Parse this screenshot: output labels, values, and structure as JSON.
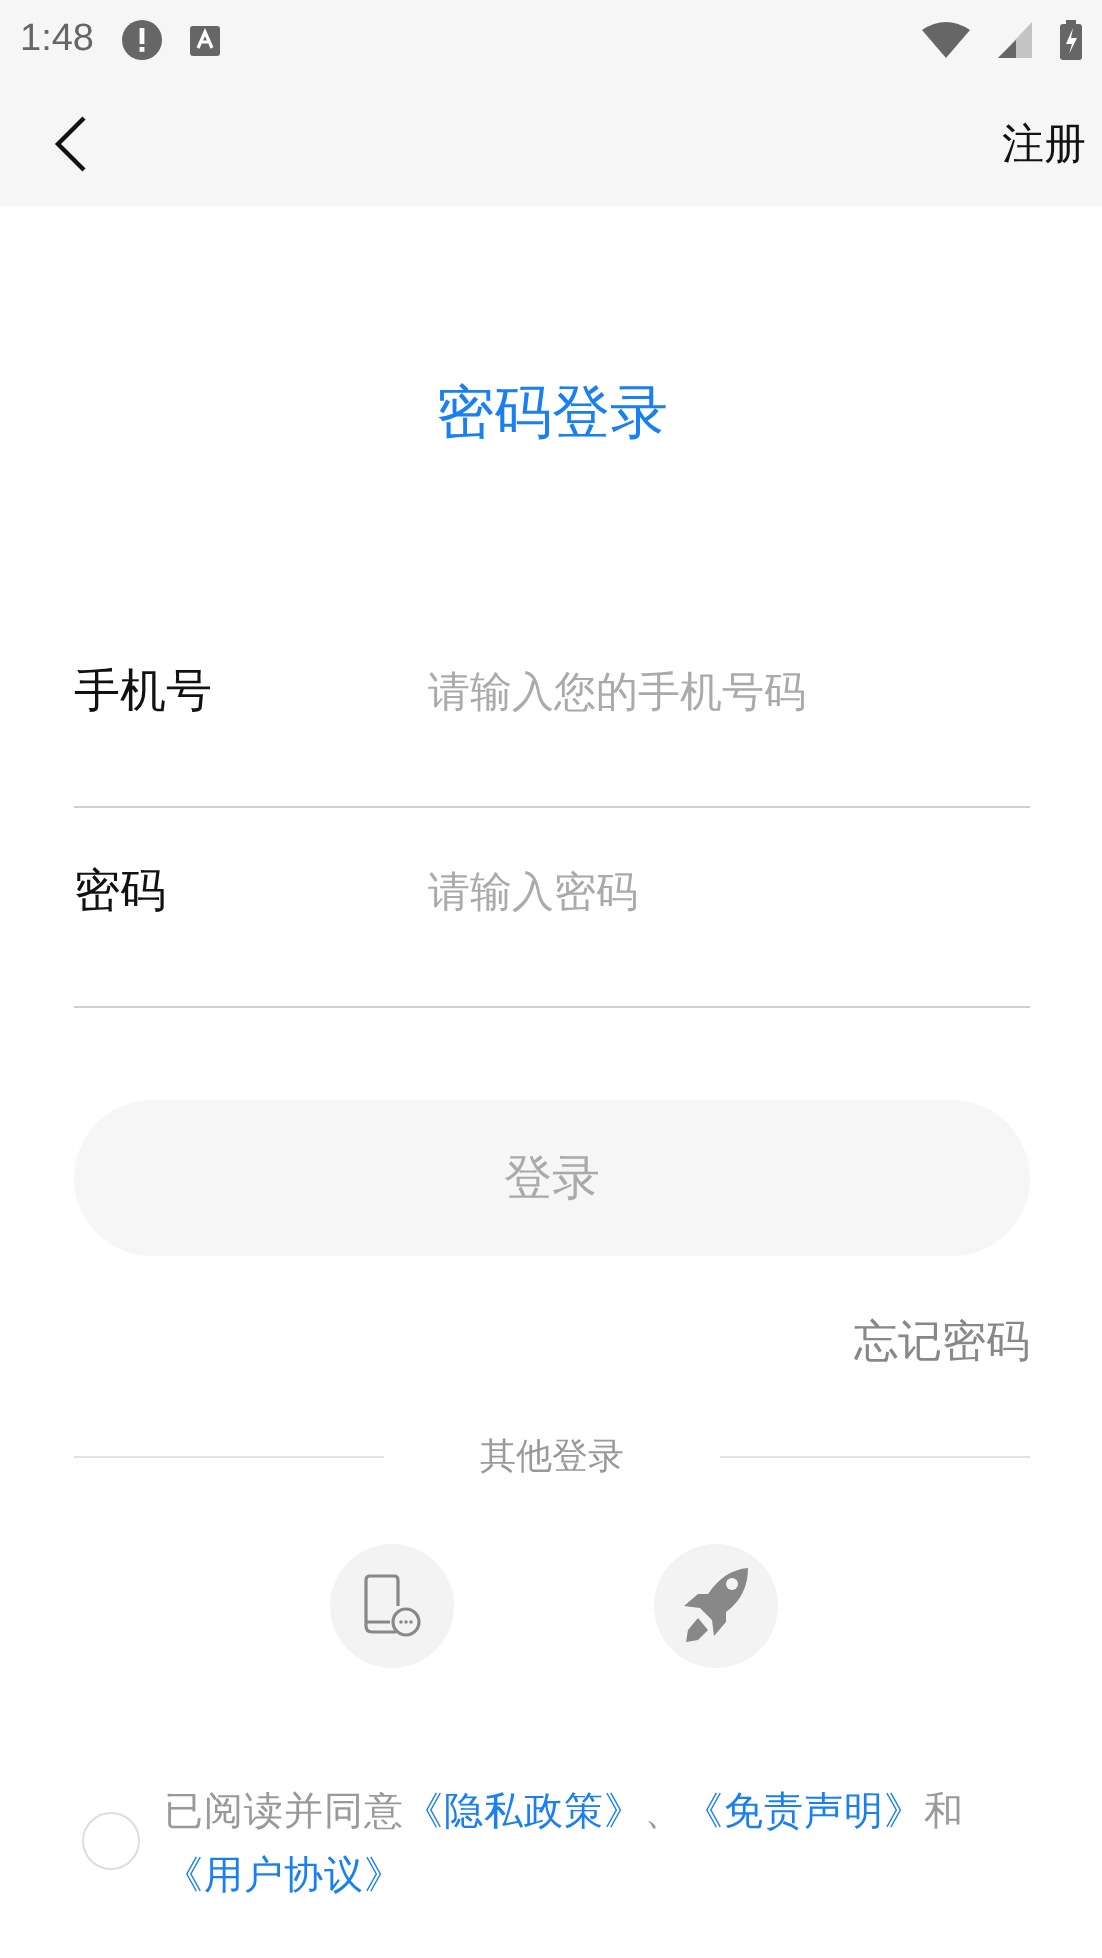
{
  "status_bar": {
    "time": "1:48"
  },
  "header": {
    "action": "注册"
  },
  "title": "密码登录",
  "fields": [
    {
      "label": "手机号",
      "placeholder": "请输入您的手机号码"
    },
    {
      "label": "密码",
      "placeholder": "请输入密码"
    }
  ],
  "login_button": {
    "label": "登录",
    "disabled": true
  },
  "forgot": "忘记密码",
  "other_login": {
    "label": "其他登录"
  },
  "agreement": {
    "checked": false,
    "parts": [
      {
        "kind": "text",
        "text": "已阅读并同意"
      },
      {
        "kind": "link",
        "text": "《隐私政策》"
      },
      {
        "kind": "text",
        "text": "、"
      },
      {
        "kind": "link",
        "text": "《免责声明》"
      },
      {
        "kind": "text",
        "text": "和"
      },
      {
        "kind": "link",
        "text": "《用户协议》"
      }
    ]
  }
}
